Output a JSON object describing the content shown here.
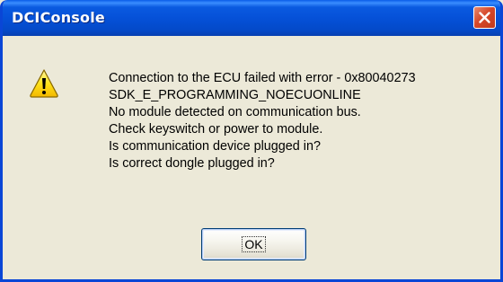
{
  "window": {
    "title": "DCIConsole"
  },
  "dialog": {
    "icon": "warning-icon",
    "message_lines": [
      "Connection to the ECU failed with error - 0x80040273",
      "SDK_E_PROGRAMMING_NOECUONLINE",
      "No module detected on communication bus.",
      "Check keyswitch or power to module.",
      "Is communication device plugged in?",
      "Is correct dongle plugged in?"
    ],
    "ok_label": "OK"
  },
  "colors": {
    "titlebar": "#0551d8",
    "close_button": "#d6482a",
    "window_background": "#ece9d8"
  }
}
